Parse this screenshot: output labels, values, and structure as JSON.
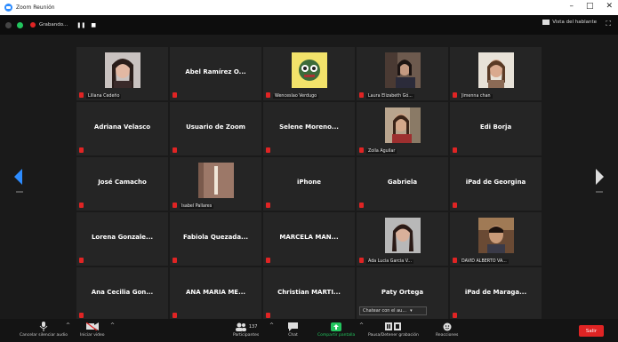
{
  "window": {
    "title": "Zoom Reunión",
    "controls": [
      "–",
      "□",
      "✕"
    ]
  },
  "topbar": {
    "recording": "Grabando...",
    "pause": "❚❚",
    "stop": "■",
    "speaker_view": "Vista del hablante",
    "fullscreen": "⛶"
  },
  "participants": [
    {
      "name": "",
      "caption": "Liliana Cedeño",
      "photo": "face-1"
    },
    {
      "name": "Abel Ramírez O...",
      "caption": ""
    },
    {
      "name": "",
      "caption": "Wenceslao Verdugo",
      "photo": "cartoon"
    },
    {
      "name": "",
      "caption": "Laura Elizabeth Gó...",
      "photo": "face-2"
    },
    {
      "name": "",
      "caption": "Jimenna chan",
      "photo": "face-3"
    },
    {
      "name": "Adriana Velasco",
      "caption": ""
    },
    {
      "name": "Usuario de Zoom",
      "caption": ""
    },
    {
      "name": "Selene Moreno...",
      "caption": ""
    },
    {
      "name": "",
      "caption": "Zoila Aguilar",
      "photo": "face-4"
    },
    {
      "name": "Edi Borja",
      "caption": ""
    },
    {
      "name": "José Camacho",
      "caption": ""
    },
    {
      "name": "",
      "caption": "Isabel Pallares",
      "photo": "door"
    },
    {
      "name": "iPhone",
      "caption": ""
    },
    {
      "name": "Gabriela",
      "caption": ""
    },
    {
      "name": "iPad de Georgina",
      "caption": ""
    },
    {
      "name": "Lorena Gonzale...",
      "caption": ""
    },
    {
      "name": "Fabiola Quezada...",
      "caption": ""
    },
    {
      "name": "MARCELA MAN...",
      "caption": ""
    },
    {
      "name": "",
      "caption": "Ada Lucia Garcia V...",
      "photo": "face-5"
    },
    {
      "name": "",
      "caption": "DAVID ALBERTO VA...",
      "photo": "face-6"
    },
    {
      "name": "Ana Cecilia Gon...",
      "caption": ""
    },
    {
      "name": "ANA MARIA ME...",
      "caption": ""
    },
    {
      "name": "Christian MARTI...",
      "caption": ""
    },
    {
      "name": "Paty Ortega",
      "caption": ""
    },
    {
      "name": "iPad de Maraga...",
      "caption": ""
    }
  ],
  "chat_popup": "Chatear con el au...",
  "chat_popup_arrow": "▾",
  "toolbar": {
    "mute": "Cancelar silenciar audio",
    "video": "Iniciar video",
    "participants": "Participantes",
    "participants_count": "137",
    "chat": "Chat",
    "share": "Compartir pantalla",
    "record": "Pausa/Detener grabación",
    "reactions": "Reacciones",
    "end": "Salir",
    "caret": "^"
  },
  "colors": {
    "accent": "#2d8cff",
    "mute_red": "#e02424",
    "share_green": "#22c55e",
    "tile_bg": "#252525"
  }
}
